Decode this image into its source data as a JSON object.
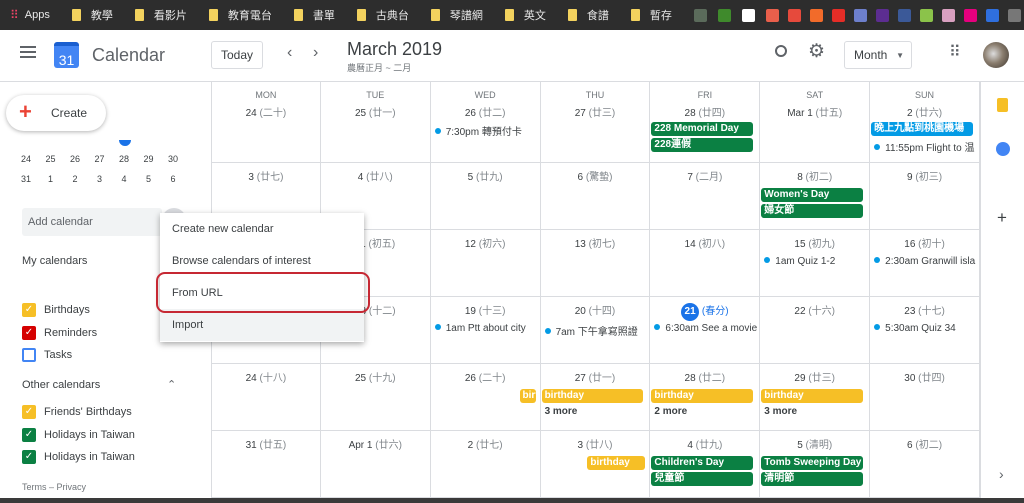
{
  "bookmarks": {
    "apps": "Apps",
    "folders": [
      "教學",
      "看影片",
      "教育電台",
      "書單",
      "古典台",
      "琴譜網",
      "英文",
      "食譜",
      "暫存"
    ],
    "favicons": [
      "#5b6b5b",
      "#3f8a2c",
      "#ffffff",
      "#e95f4b",
      "#e64a3c",
      "#f26b2a",
      "#e52d27",
      "#6d7fcc",
      "#5c2d91",
      "#3b5998",
      "#8bc34a",
      "#d9a0c0",
      "#e6007e",
      "#2f6fde",
      "#777777",
      "#2a6ab0"
    ],
    "overflow": "»"
  },
  "header": {
    "app_name": "Calendar",
    "logo_day": "31",
    "today": "Today",
    "month_title": "March 2019",
    "lunar_subtitle": "農曆正月 ~ 二月",
    "view": "Month",
    "accent": "#1a73e8"
  },
  "sidebar": {
    "create": "Create",
    "mini_rows": [
      [
        "24",
        "25",
        "26",
        "27",
        "28",
        "29",
        "30"
      ],
      [
        "31",
        "1",
        "2",
        "3",
        "4",
        "5",
        "6"
      ]
    ],
    "add_calendar_placeholder": "Add calendar",
    "my_calendars": "My calendars",
    "my": [
      {
        "label": "Birthdays",
        "color": "#f6bf26",
        "checked": true
      },
      {
        "label": "Reminders",
        "color": "#d50000",
        "checked": true
      },
      {
        "label": "Tasks",
        "color": "#4285f4",
        "checked": false
      }
    ],
    "other_calendars": "Other calendars",
    "other": [
      {
        "label": "Friends' Birthdays",
        "color": "#f6bf26",
        "checked": true
      },
      {
        "label": "Holidays in Taiwan",
        "color": "#0b8043",
        "checked": true
      },
      {
        "label": "Holidays in Taiwan",
        "color": "#0b8043",
        "checked": true
      }
    ],
    "footer": "Terms – Privacy"
  },
  "menu": {
    "items": [
      "Create new calendar",
      "Browse calendars of interest",
      "From URL",
      "Import"
    ],
    "highlighted": "From URL"
  },
  "calendar": {
    "weekdays": [
      "MON",
      "TUE",
      "WED",
      "THU",
      "FRI",
      "SAT",
      "SUN"
    ],
    "colors": {
      "holiday": "#0b8043",
      "birthday": "#f6bf26",
      "event": "#039be5"
    },
    "weeks": [
      [
        {
          "d": "24",
          "l": "(二十)"
        },
        {
          "d": "25",
          "l": "(廿一)"
        },
        {
          "d": "26",
          "l": "(廿二)",
          "ev": [
            "7:30pm 轉預付卡"
          ]
        },
        {
          "d": "27",
          "l": "(廿三)"
        },
        {
          "d": "28",
          "l": "(廿四)",
          "chips": [
            {
              "t": "228 Memorial Day",
              "c": "holiday"
            },
            {
              "t": "228連假",
              "c": "holiday"
            }
          ]
        },
        {
          "d": "Mar 1",
          "l": "(廿五)"
        },
        {
          "d": "2",
          "l": "(廿六)",
          "chips": [
            {
              "t": "晚上九點到桃園機場",
              "c": "event"
            }
          ],
          "ev2": [
            "11:55pm Flight to 温"
          ]
        }
      ],
      [
        {
          "d": "3",
          "l": "(廿七)"
        },
        {
          "d": "4",
          "l": "(廿八)"
        },
        {
          "d": "5",
          "l": "(廿九)"
        },
        {
          "d": "6",
          "l": "(驚蟄)"
        },
        {
          "d": "7",
          "l": "(二月)"
        },
        {
          "d": "8",
          "l": "(初二)",
          "chips": [
            {
              "t": "Women's Day",
              "c": "holiday"
            },
            {
              "t": "婦女節",
              "c": "holiday"
            }
          ]
        },
        {
          "d": "9",
          "l": "(初三)"
        }
      ],
      [
        {
          "d": "10",
          "l": "(初四)"
        },
        {
          "d": "11",
          "l": "(初五)"
        },
        {
          "d": "12",
          "l": "(初六)"
        },
        {
          "d": "13",
          "l": "(初七)"
        },
        {
          "d": "14",
          "l": "(初八)"
        },
        {
          "d": "15",
          "l": "(初九)",
          "ev": [
            "1am Quiz 1-2"
          ]
        },
        {
          "d": "16",
          "l": "(初十)",
          "ev": [
            "2:30am Granwill isla"
          ]
        }
      ],
      [
        {
          "d": "17",
          "l": "(十一)"
        },
        {
          "d": "18",
          "l": "(十二)"
        },
        {
          "d": "19",
          "l": "(十三)",
          "ev": [
            "1am Ptt about city"
          ]
        },
        {
          "d": "20",
          "l": "(十四)",
          "ev": [
            "7am 下午拿寫照證"
          ]
        },
        {
          "d": "21",
          "l": "(春分)",
          "today": true,
          "ev": [
            "6:30am See a movie"
          ]
        },
        {
          "d": "22",
          "l": "(十六)"
        },
        {
          "d": "23",
          "l": "(十七)",
          "ev": [
            "5:30am Quiz 34"
          ]
        }
      ],
      [
        {
          "d": "24",
          "l": "(十八)"
        },
        {
          "d": "25",
          "l": "(十九)"
        },
        {
          "d": "26",
          "l": "(二十)",
          "chips": [
            {
              "t": "birt",
              "c": "birthday",
              "right": true
            }
          ]
        },
        {
          "d": "27",
          "l": "(廿一)",
          "chips": [
            {
              "t": "birthday",
              "c": "birthday"
            }
          ],
          "more": "3 more"
        },
        {
          "d": "28",
          "l": "(廿二)",
          "chips": [
            {
              "t": "birthday",
              "c": "birthday"
            }
          ],
          "more": "2 more"
        },
        {
          "d": "29",
          "l": "(廿三)",
          "chips": [
            {
              "t": "birthday",
              "c": "birthday"
            }
          ],
          "more": "3 more"
        },
        {
          "d": "30",
          "l": "(廿四)"
        }
      ],
      [
        {
          "d": "31",
          "l": "(廿五)"
        },
        {
          "d": "Apr 1",
          "l": "(廿六)"
        },
        {
          "d": "2",
          "l": "(廿七)"
        },
        {
          "d": "3",
          "l": "(廿八)",
          "chips": [
            {
              "t": "birthday",
              "c": "birthday",
              "right": true
            }
          ]
        },
        {
          "d": "4",
          "l": "(廿九)",
          "chips": [
            {
              "t": "Children's Day",
              "c": "holiday"
            },
            {
              "t": "兒童節",
              "c": "holiday"
            }
          ]
        },
        {
          "d": "5",
          "l": "(清明)",
          "chips": [
            {
              "t": "Tomb Sweeping Day",
              "c": "holiday"
            },
            {
              "t": "清明節",
              "c": "holiday"
            }
          ]
        },
        {
          "d": "6",
          "l": "(初二)"
        }
      ]
    ]
  },
  "right_panel": {
    "icons": [
      "keep-icon",
      "tasks-icon",
      "add-icon",
      "expand-icon"
    ]
  }
}
